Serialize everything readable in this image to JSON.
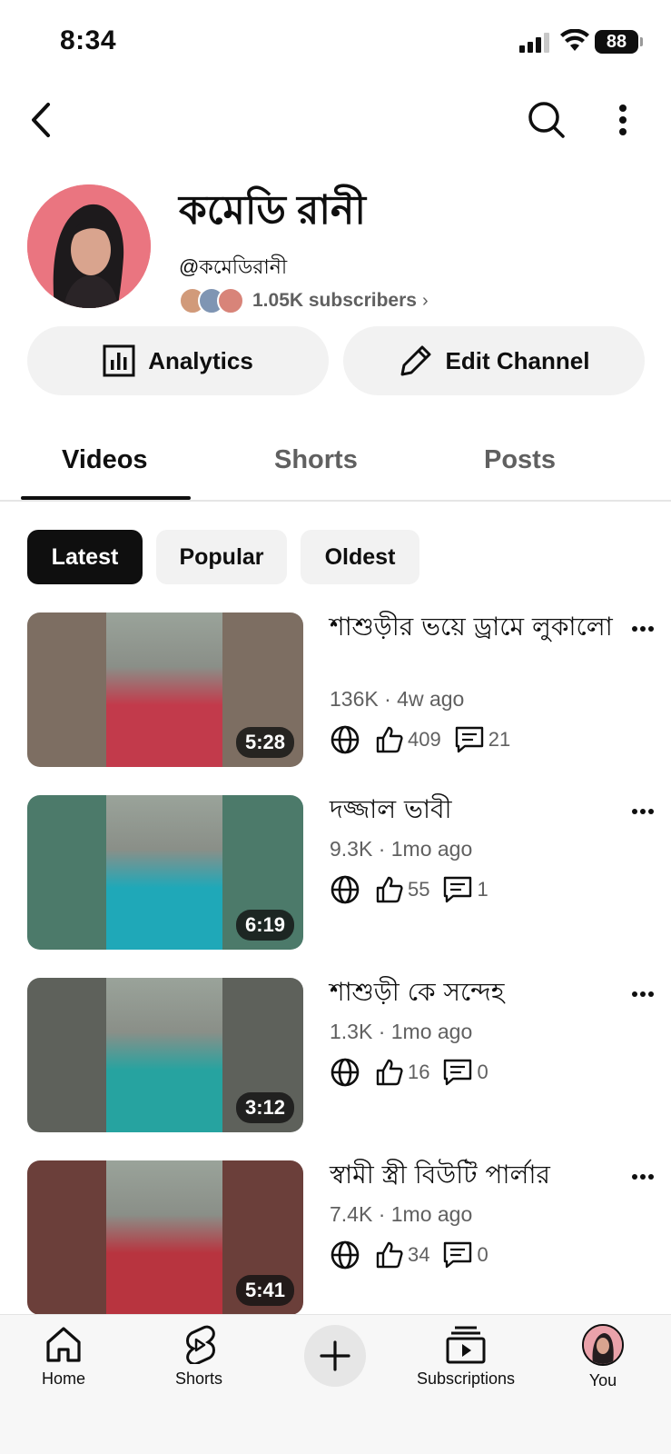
{
  "status_bar": {
    "time": "8:34",
    "battery": "88"
  },
  "channel": {
    "name": "কমেডি রানী",
    "handle": "@কমেডিরানী",
    "subscribers": "1.05K subscribers",
    "analytics_label": "Analytics",
    "edit_label": "Edit Channel"
  },
  "tabs": [
    {
      "label": "Videos"
    },
    {
      "label": "Shorts"
    },
    {
      "label": "Posts"
    }
  ],
  "chips": [
    {
      "label": "Latest"
    },
    {
      "label": "Popular"
    },
    {
      "label": "Oldest"
    }
  ],
  "videos": [
    {
      "title": "শাশুড়ীর ভয়ে ড্রামে লুকালো",
      "meta": "136K · 4w ago",
      "likes": "409",
      "comments": "21",
      "duration": "5:28",
      "bg": "#7d6e62",
      "fg": "#c23a4b"
    },
    {
      "title": "দজ্জাল ভাবী",
      "meta": "9.3K · 1mo ago",
      "likes": "55",
      "comments": "1",
      "duration": "6:19",
      "bg": "#4c7a6a",
      "fg": "#1fa8b8"
    },
    {
      "title": "শাশুড়ী কে সন্দেহ",
      "meta": "1.3K · 1mo ago",
      "likes": "16",
      "comments": "0",
      "duration": "3:12",
      "bg": "#5e615b",
      "fg": "#26a3a0"
    },
    {
      "title": "স্বামী স্ত্রী বিউটি পার্লার",
      "meta": "7.4K · 1mo ago",
      "likes": "34",
      "comments": "0",
      "duration": "5:41",
      "bg": "#6b3f3a",
      "fg": "#b8343f"
    }
  ],
  "bottom_nav": {
    "home": "Home",
    "shorts": "Shorts",
    "subscriptions": "Subscriptions",
    "you": "You"
  },
  "colors": {
    "accent": "#0f0f0f",
    "secondary_text": "#606060",
    "chip_bg": "#f2f2f2"
  }
}
